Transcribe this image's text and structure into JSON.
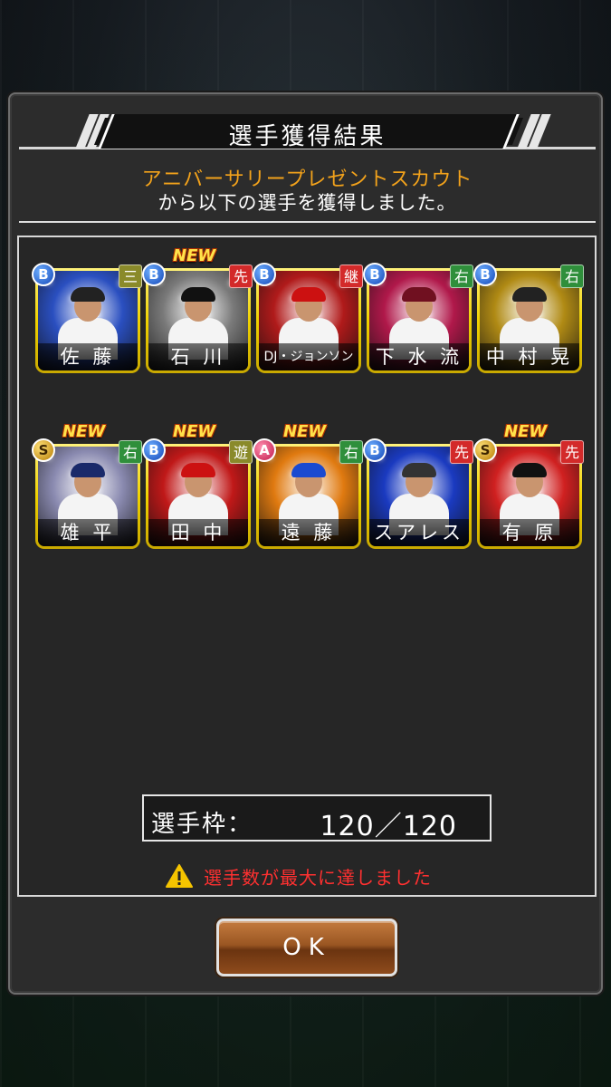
{
  "dialog": {
    "title": "選手獲得結果",
    "scout_name": "アニバーサリープレゼントスカウト",
    "message": "から以下の選手を獲得しました。",
    "new_label": "NEW",
    "players": [
      {
        "name": "佐 藤",
        "rank": "B",
        "position": "三",
        "pos_color": "olive",
        "new": false,
        "bg": "#2a4fc0",
        "cap": "#222"
      },
      {
        "name": "石 川",
        "rank": "B",
        "position": "先",
        "pos_color": "red",
        "new": true,
        "bg": "#7a7a7a",
        "cap": "#111"
      },
      {
        "name": "DJ・ジョンソン",
        "rank": "B",
        "position": "継",
        "pos_color": "red",
        "new": false,
        "bg": "#b01a1a",
        "cap": "#c11"
      },
      {
        "name": "下 水 流",
        "rank": "B",
        "position": "右",
        "pos_color": "green",
        "new": false,
        "bg": "#b0184a",
        "cap": "#701020"
      },
      {
        "name": "中 村 晃",
        "rank": "B",
        "position": "右",
        "pos_color": "green",
        "new": false,
        "bg": "#b08a14",
        "cap": "#222"
      },
      {
        "name": "雄 平",
        "rank": "S",
        "position": "右",
        "pos_color": "green",
        "new": true,
        "bg": "#8a8ab0",
        "cap": "#1a2a6a"
      },
      {
        "name": "田 中",
        "rank": "B",
        "position": "遊",
        "pos_color": "olive",
        "new": true,
        "bg": "#c01818",
        "cap": "#c11"
      },
      {
        "name": "遠 藤",
        "rank": "A",
        "position": "右",
        "pos_color": "green",
        "new": true,
        "bg": "#e07a10",
        "cap": "#1a4ad0"
      },
      {
        "name": "スアレス",
        "rank": "B",
        "position": "先",
        "pos_color": "red",
        "new": false,
        "bg": "#1a3ac0",
        "cap": "#333"
      },
      {
        "name": "有 原",
        "rank": "S",
        "position": "先",
        "pos_color": "red",
        "new": true,
        "bg": "#d02020",
        "cap": "#111"
      }
    ],
    "roster_label": "選手枠：",
    "roster_value": "120／120",
    "warning": "選手数が最大に達しました",
    "ok_label": "OK"
  },
  "colors": {
    "accent_orange": "#f2a21b",
    "warning_red": "#ff3030",
    "card_gold": "#f0d200"
  },
  "icons": [
    "warning-icon"
  ]
}
